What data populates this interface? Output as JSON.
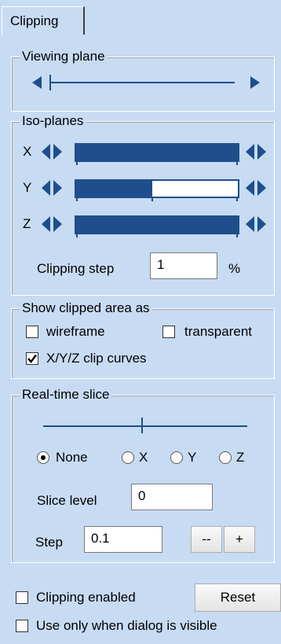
{
  "tab": {
    "label": "Clipping"
  },
  "viewing_plane": {
    "legend": "Viewing plane",
    "slider_position": 0.0
  },
  "iso_planes": {
    "legend": "Iso-planes",
    "axes": [
      {
        "label": "X",
        "fill_fraction": 1.0
      },
      {
        "label": "Y",
        "fill_fraction": 0.47
      },
      {
        "label": "Z",
        "fill_fraction": 1.0
      }
    ],
    "clipping_step": {
      "label": "Clipping step",
      "value": "1",
      "unit": "%"
    }
  },
  "show_clipped_area": {
    "legend": "Show clipped area as",
    "wireframe": {
      "label": "wireframe",
      "checked": false
    },
    "transparent": {
      "label": "transparent",
      "checked": false
    },
    "clip_curves": {
      "label": "X/Y/Z clip curves",
      "checked": true
    }
  },
  "real_time_slice": {
    "legend": "Real-time slice",
    "slider_position": 0.48,
    "radios": [
      {
        "label": "None",
        "selected": true
      },
      {
        "label": "X",
        "selected": false
      },
      {
        "label": "Y",
        "selected": false
      },
      {
        "label": "Z",
        "selected": false
      }
    ],
    "slice_level": {
      "label": "Slice level",
      "value": "0"
    },
    "step": {
      "label": "Step",
      "value": "0.1"
    },
    "decrement_label": "--",
    "increment_label": "+"
  },
  "footer": {
    "clipping_enabled": {
      "label": "Clipping enabled",
      "checked": false
    },
    "reset_label": "Reset",
    "dialog_only": {
      "label": "Use only when dialog is visible",
      "checked": false
    }
  }
}
